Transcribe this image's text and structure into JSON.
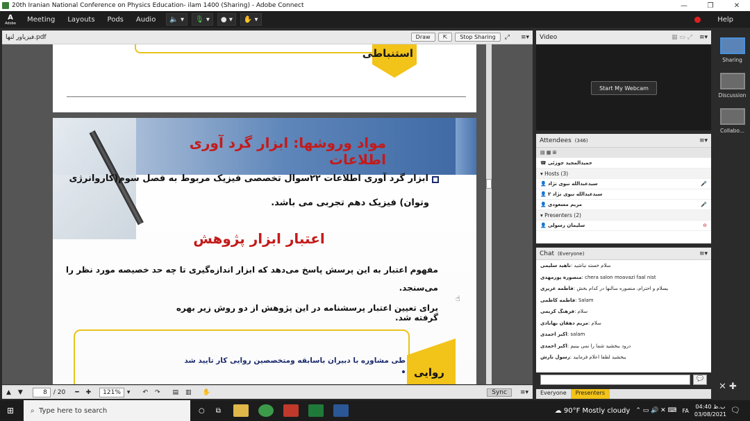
{
  "window": {
    "title": "20th Iranian National Conference on Physics Education- ilam 1400 (Sharing) - Adobe Connect"
  },
  "menu": {
    "logo": "Adobe",
    "items": [
      "Meeting",
      "Layouts",
      "Pods",
      "Audio"
    ],
    "help": "Help"
  },
  "share_pod": {
    "file_name": "فیزیاور لنها.pdf",
    "draw_label": "Draw",
    "stop_label": "Stop Sharing"
  },
  "page_top": {
    "badge_text": "استنباطی"
  },
  "slide": {
    "title": "مواد وروشها: ابزار گرد آوری اطلاعات",
    "bullet_line1": "ابزار گرد آوری اطلاعات ۲۲سوال تخصصی فیزیک مربوط به فصل سوم(کاروانرژی",
    "bullet_line2": "وتوان) فیزیک دهم تجربی می باشد.",
    "heading2": "اعتبار ابزار پژوهش",
    "para1_line1": "مفهوم اعتبار به این پرسش پاسخ می‌دهد که ابزار اندازه‌گیری تا چه حد خصیصه مورد نظر را",
    "para1_line2": "می‌سنجد.",
    "para2": "برای تعیین اعتبار پرسشنامه در این پژوهش از دو روش زیر بهره گرفته شد.",
    "box_text": "طی مشاوره با دبیران باسابقه ومتخصصین روایی کار تایید شد",
    "badge_text": "روایی"
  },
  "doc_toolbar": {
    "page": "8",
    "total": "/ 20",
    "zoom": "121%",
    "sync": "Sync"
  },
  "video_pod": {
    "title": "Video",
    "webcam_button": "Start My Webcam"
  },
  "attendees": {
    "title": "Attendees",
    "count": "(346)",
    "me": "حمیدالمجید جوزئی",
    "hosts_label": "Hosts (3)",
    "hosts": [
      "سیدعبدالله نبوی نژاد",
      "سیدعبدالله نبوی نژاد ۲",
      "مریم مسعودی"
    ],
    "presenters_label": "Presenters (2)",
    "presenters": [
      "سلیمان رسولی"
    ]
  },
  "chat": {
    "title": "Chat",
    "scope": "(Everyone)",
    "lines": [
      {
        "name": "ناهید سلیمی",
        "text": "سلام خسته نباشید"
      },
      {
        "name": "منصوره پورمهدی",
        "text": "chera salon moavazi faal nist"
      },
      {
        "name": "فاطمه عزیزی",
        "text": "یسلام و احترام، منصوره سالنها در کدام بخش"
      },
      {
        "name": "فاطمه کاظمی",
        "text": "Salam"
      },
      {
        "name": "فرهنگ کریمی",
        "text": "سلام"
      },
      {
        "name": "مریم دهقان بهابادی",
        "text": "سلام"
      },
      {
        "name": "اکبر احمدی",
        "text": "salam"
      },
      {
        "name": "اکبر احمدی",
        "text": "درود ببخشید شما را نمی بینیم"
      },
      {
        "name": "رسول نارش",
        "text": "ببخشید لطفا اعلام فرمایید"
      }
    ],
    "tabs": [
      "Everyone",
      "Presenters"
    ]
  },
  "rail": {
    "items": [
      "Sharing",
      "Discussion",
      "Collabo..."
    ]
  },
  "taskbar": {
    "search_placeholder": "Type here to search",
    "weather": "90°F  Mostly cloudy",
    "time": "04:40 ب.ظ",
    "date": "03/08/2021",
    "lang": "FA"
  },
  "colors": {
    "accent_red": "#c41a1a",
    "gold": "#f2c319",
    "navy": "#1a2a6b",
    "slide_band": "#3d67a3"
  }
}
